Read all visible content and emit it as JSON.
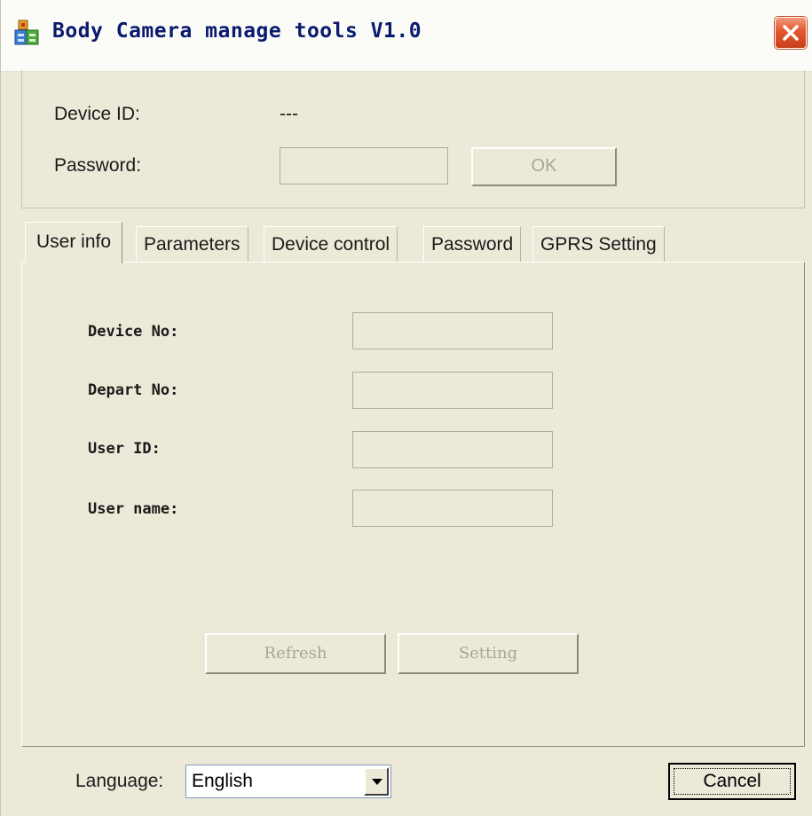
{
  "window": {
    "title": "Body Camera manage tools V1.0",
    "icons": {
      "app": "app-icon",
      "close": "close-icon"
    }
  },
  "login": {
    "device_id_label": "Device ID:",
    "device_id_value": "---",
    "password_label": "Password:",
    "password_value": "",
    "ok_label": "OK"
  },
  "tabs": [
    {
      "label": "User info",
      "active": true
    },
    {
      "label": "Parameters"
    },
    {
      "label": "Device control"
    },
    {
      "label": "Password"
    },
    {
      "label": "GPRS Setting"
    }
  ],
  "user_info": {
    "fields": [
      {
        "label": "Device No:",
        "value": ""
      },
      {
        "label": "Depart No:",
        "value": ""
      },
      {
        "label": "User ID:",
        "value": ""
      },
      {
        "label": "User name:",
        "value": ""
      }
    ],
    "refresh_label": "Refresh",
    "setting_label": "Setting"
  },
  "footer": {
    "language_label": "Language:",
    "language_value": "English",
    "cancel_label": "Cancel"
  },
  "colors": {
    "face": "#ece9d8",
    "title_text": "#0a1a6e",
    "close_red": "#e2562c",
    "disabled_text": "#a9a697"
  }
}
